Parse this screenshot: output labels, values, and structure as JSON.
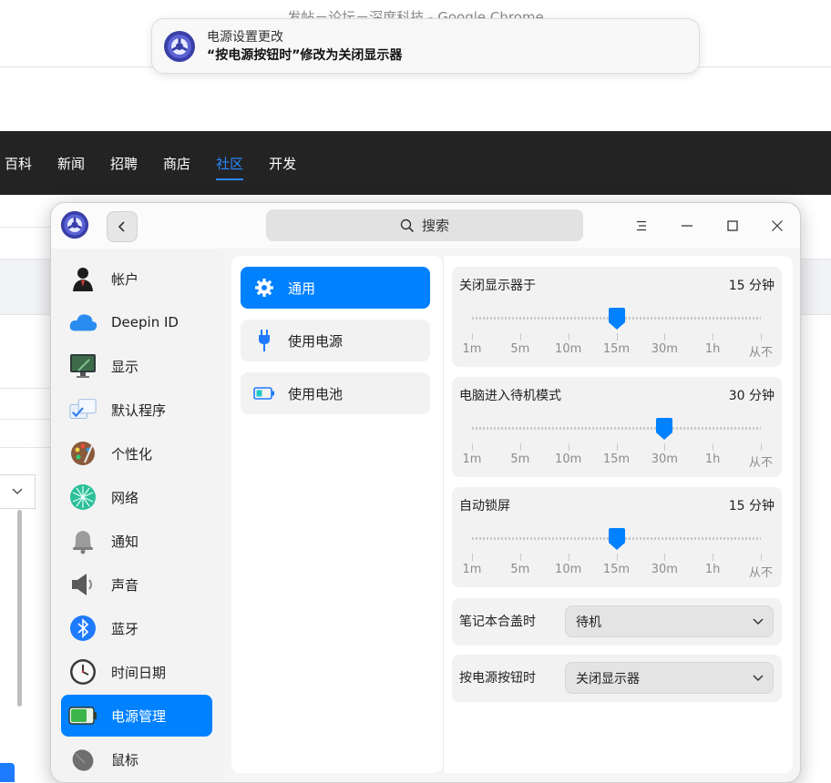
{
  "browser": {
    "title": "发帖－论坛－深度科技 - Google Chrome",
    "nav": [
      "百科",
      "新闻",
      "招聘",
      "商店",
      "社区",
      "开发"
    ],
    "nav_active": "社区"
  },
  "notification": {
    "title": "电源设置更改",
    "body": "“按电源按钮时”修改为关闭显示器"
  },
  "window": {
    "search_placeholder": "搜索",
    "accent": "#0081ff"
  },
  "sidebar": {
    "items": [
      {
        "label": "帐户",
        "icon": "user-account-icon"
      },
      {
        "label": "Deepin ID",
        "icon": "cloud-icon"
      },
      {
        "label": "显示",
        "icon": "monitor-icon"
      },
      {
        "label": "默认程序",
        "icon": "default-apps-icon"
      },
      {
        "label": "个性化",
        "icon": "palette-icon"
      },
      {
        "label": "网络",
        "icon": "network-icon"
      },
      {
        "label": "通知",
        "icon": "bell-icon"
      },
      {
        "label": "声音",
        "icon": "speaker-icon"
      },
      {
        "label": "蓝牙",
        "icon": "bluetooth-icon"
      },
      {
        "label": "时间日期",
        "icon": "clock-icon"
      },
      {
        "label": "电源管理",
        "icon": "battery-icon",
        "active": true
      },
      {
        "label": "鼠标",
        "icon": "mouse-icon"
      }
    ]
  },
  "power_menu": {
    "items": [
      {
        "label": "通用",
        "icon": "gear-icon",
        "active": true
      },
      {
        "label": "使用电源",
        "icon": "plug-icon"
      },
      {
        "label": "使用电池",
        "icon": "battery-small-icon"
      }
    ]
  },
  "settings": {
    "tick_labels": [
      "1m",
      "5m",
      "10m",
      "15m",
      "30m",
      "1h",
      "从不"
    ],
    "sliders": [
      {
        "label": "关闭显示器于",
        "value_text": "15 分钟",
        "level_index": 3
      },
      {
        "label": "电脑进入待机模式",
        "value_text": "30 分钟",
        "level_index": 4
      },
      {
        "label": "自动锁屏",
        "value_text": "15 分钟",
        "level_index": 3
      }
    ],
    "combos": [
      {
        "label": "笔记本合盖时",
        "value": "待机"
      },
      {
        "label": "按电源按钮时",
        "value": "关闭显示器"
      }
    ]
  }
}
